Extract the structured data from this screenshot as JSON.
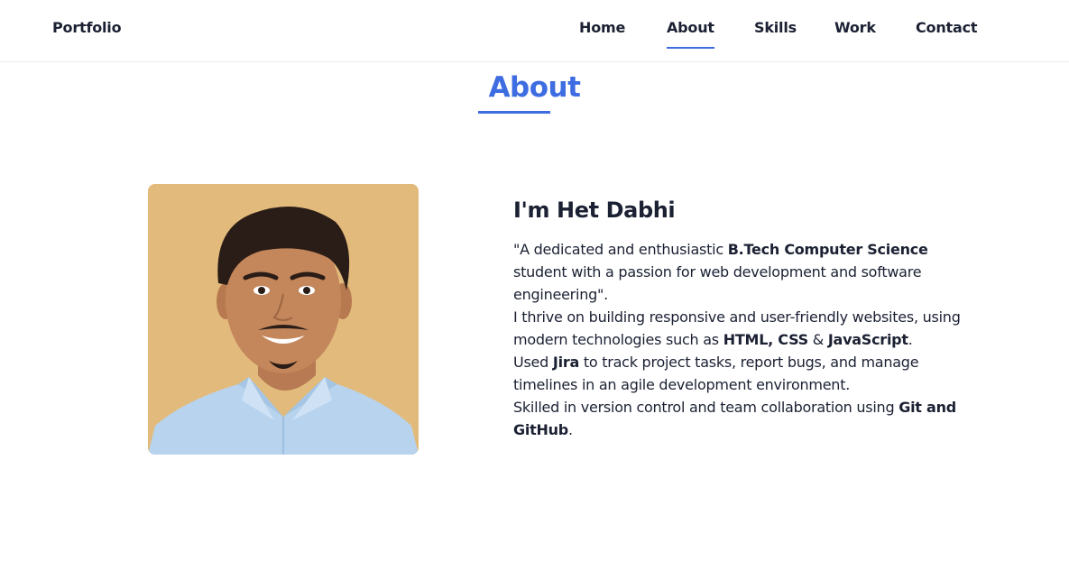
{
  "header": {
    "logo": "Portfolio",
    "nav": [
      {
        "label": "Home",
        "active": false
      },
      {
        "label": "About",
        "active": true
      },
      {
        "label": "Skills",
        "active": false
      },
      {
        "label": "Work",
        "active": false
      },
      {
        "label": "Contact",
        "active": false
      }
    ]
  },
  "about": {
    "section_title": "About",
    "name_heading": "I'm Het Dabhi",
    "photo_icon": "profile-photo",
    "p1": {
      "t1": "\"A dedicated and enthusiastic ",
      "b1": "B.Tech Computer Science",
      "t2": " student with a passion for web development and software engineering\"."
    },
    "p2": {
      "t1": "I thrive on building responsive and user-friendly websites, using modern technologies such as ",
      "b1": "HTML, CSS",
      "t2": " & ",
      "b2": "JavaScript",
      "t3": "."
    },
    "p3": {
      "t1": "Used ",
      "b1": "Jira",
      "t2": " to track project tasks, report bugs, and manage timelines in an agile development environment."
    },
    "p4": {
      "t1": "Skilled in version control and team collaboration using ",
      "b1": "Git and GitHub",
      "t2": "."
    }
  },
  "colors": {
    "accent": "#3e6ce1",
    "text": "#1b2133",
    "photo_background": "#e2bb7c"
  }
}
